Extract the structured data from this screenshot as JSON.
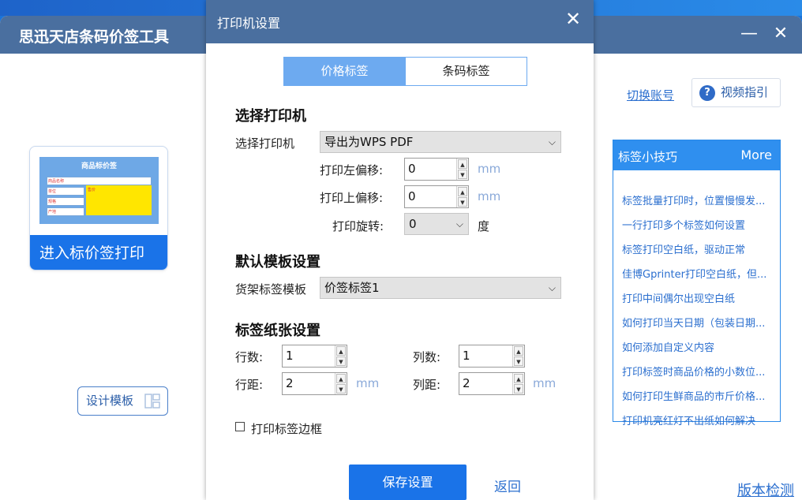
{
  "app": {
    "title": "思迅天店条码价签工具",
    "minimize": "—",
    "close": "✕",
    "card_label": "进入标价签打印",
    "thumb": {
      "title": "商品标价签",
      "row_labels": [
        "商品名称",
        "单位",
        "规格",
        "产地"
      ],
      "price_label": "售价"
    },
    "design_button": "设计模板",
    "switch_account": "切换账号",
    "video_guide": "视频指引",
    "version_check": "版本检测"
  },
  "tips": {
    "title": "标签小技巧",
    "more": "More",
    "items": [
      "标签批量打印时，位置慢慢发...",
      "一行打印多个标签如何设置",
      "标签打印空白纸，驱动正常",
      "佳博Gprinter打印空白纸，但...",
      "打印中间偶尔出现空白纸",
      "如何打印当天日期（包装日期...",
      "如何添加自定义内容",
      "打印标签时商品价格的小数位...",
      "如何打印生鲜商品的市斤价格...",
      "打印机亮红灯不出纸如何解决"
    ]
  },
  "dialog": {
    "title": "打印机设置",
    "close": "✕",
    "tabs": [
      "价格标签",
      "条码标签"
    ],
    "section_printer": "选择打印机",
    "printer_label": "选择打印机",
    "printer_value": "导出为WPS PDF",
    "left_offset_label": "打印左偏移:",
    "left_offset_value": "0",
    "top_offset_label": "打印上偏移:",
    "top_offset_value": "0",
    "rotation_label": "打印旋转:",
    "rotation_value": "0",
    "rotation_unit": "度",
    "unit_mm": "mm",
    "section_template": "默认模板设置",
    "template_label": "货架标签模板",
    "template_value": "价签标签1",
    "section_paper": "标签纸张设置",
    "rows_label": "行数:",
    "rows_value": "1",
    "cols_label": "列数:",
    "cols_value": "1",
    "row_gap_label": "行距:",
    "row_gap_value": "2",
    "col_gap_label": "列距:",
    "col_gap_value": "2",
    "border_checkbox": "打印标签边框",
    "save": "保存设置",
    "back": "返回"
  },
  "colors": {
    "header": "#4a6f9f",
    "primary": "#1a73e8",
    "link": "#2b6fcf",
    "tab_active": "#6daaf0",
    "price_block": "#ffe600"
  }
}
